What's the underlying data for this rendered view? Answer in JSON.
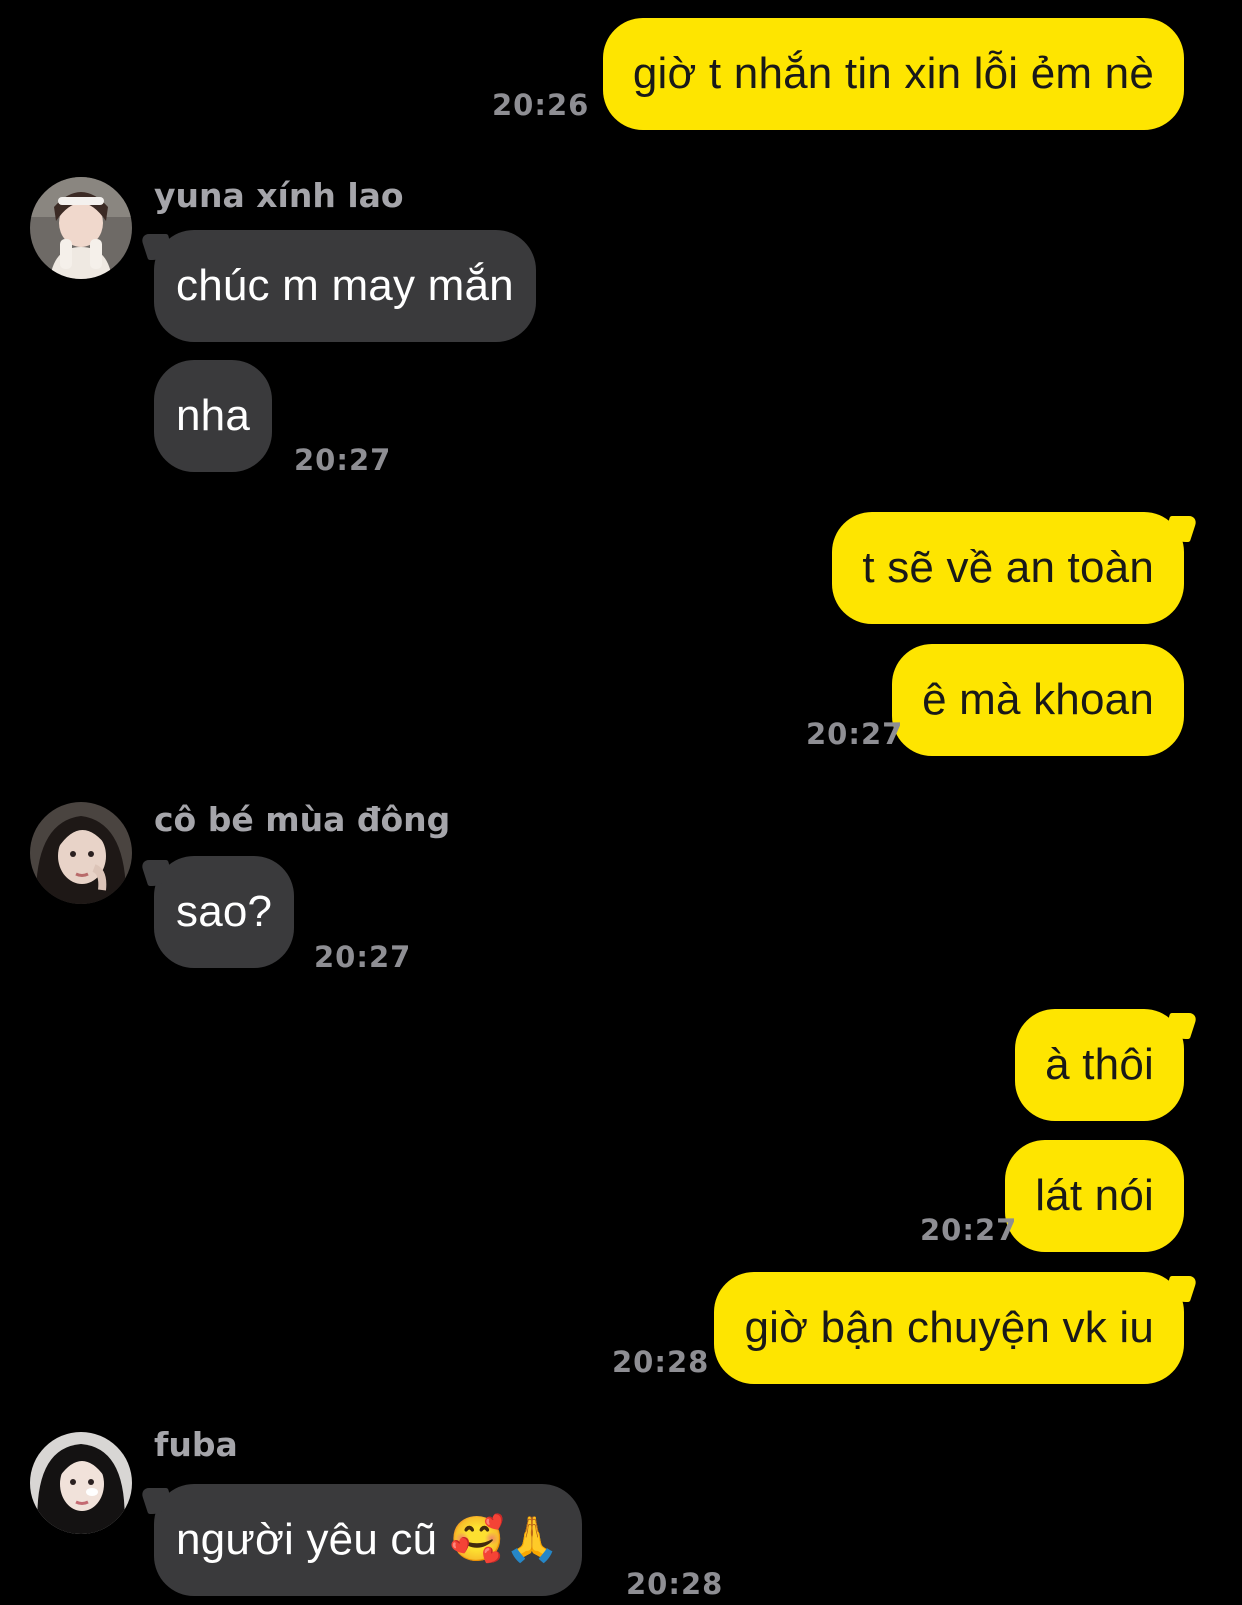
{
  "messages": {
    "m1": {
      "text": "giờ t nhắn tin xin lỗi ẻm nè",
      "time": "20:26"
    },
    "group1": {
      "sender": "yuna xính lao",
      "m2": {
        "text": "chúc m may mắn"
      },
      "m3": {
        "text": "nha",
        "time": "20:27"
      }
    },
    "m4": {
      "text": "t sẽ về an toàn"
    },
    "m5": {
      "text": "ê mà khoan",
      "time": "20:27"
    },
    "group2": {
      "sender": "cô bé mùa đông",
      "m6": {
        "text": "sao?",
        "time": "20:27"
      }
    },
    "m7": {
      "text": "à thôi"
    },
    "m8": {
      "text": "lát nói",
      "time": "20:27"
    },
    "m9": {
      "text": "giờ bận chuyện vk iu",
      "time": "20:28"
    },
    "group3": {
      "sender": "fuba",
      "m10": {
        "text": "người yêu cũ",
        "emoji": "🥰🙏",
        "time": "20:28"
      }
    }
  },
  "theme": {
    "outgoing_bubble": "#FEE500",
    "incoming_bubble": "#3A3A3C",
    "background": "#000000",
    "timestamp": "#8E8E93"
  },
  "icons": [
    "avatar-yuna",
    "avatar-co-be-mua-dong",
    "avatar-fuba"
  ]
}
